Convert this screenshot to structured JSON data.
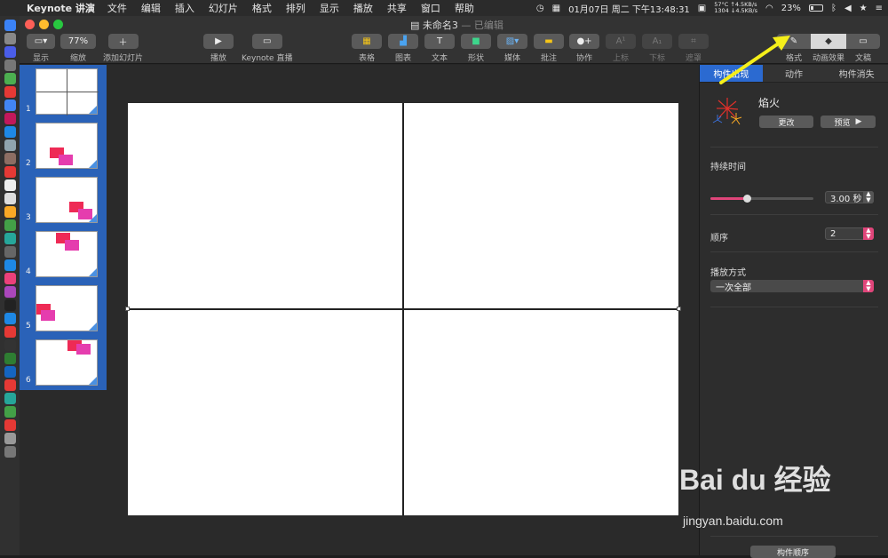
{
  "menubar": {
    "app_name": "Keynote 讲演",
    "items": [
      "文件",
      "编辑",
      "插入",
      "幻灯片",
      "格式",
      "排列",
      "显示",
      "播放",
      "共享",
      "窗口",
      "帮助"
    ],
    "datetime": "01月07日 周二 下午13:48:31",
    "temp": "57°C",
    "fan": "1304",
    "net_up": "↑4.5KB/s",
    "net_down": "↓4.5KB/s",
    "battery": "23%"
  },
  "window": {
    "title": "未命名3",
    "title_suffix": "— 已编辑"
  },
  "toolbar": {
    "view_label": "显示",
    "zoom_value": "77%",
    "zoom_label": "缩放",
    "add_slide_label": "添加幻灯片",
    "play_label": "播放",
    "keynote_live_label": "Keynote 直播",
    "table_label": "表格",
    "chart_label": "图表",
    "text_label": "文本",
    "shape_label": "形状",
    "media_label": "媒体",
    "comment_label": "批注",
    "collab_label": "协作",
    "superscript_label": "上标",
    "subscript_label": "下标",
    "mask_label": "遮罩",
    "format_label": "格式",
    "animate_label": "动画效果",
    "document_label": "文稿"
  },
  "slides": [
    {
      "number": "1"
    },
    {
      "number": "2"
    },
    {
      "number": "3"
    },
    {
      "number": "4"
    },
    {
      "number": "5"
    },
    {
      "number": "6"
    }
  ],
  "inspector": {
    "tabs": [
      "构件出现",
      "动作",
      "构件消失"
    ],
    "effect_name": "焰火",
    "change_button": "更改",
    "preview_button": "预览",
    "duration_label": "持续时间",
    "duration_value": "3.00 秒",
    "duration_fraction": 0.35,
    "order_label": "顺序",
    "order_value": "2",
    "delivery_label": "播放方式",
    "delivery_value": "一次全部",
    "build_order_button": "构件顺序"
  },
  "watermark": {
    "logo": "Bai du 经验",
    "url": "jingyan.baidu.com"
  },
  "colors": {
    "accent": "#2b6ad1",
    "control_accent": "#e0457a",
    "arrow": "#f5ef1a",
    "shape_red": "#ee2a55",
    "shape_pink": "#e53dae"
  }
}
